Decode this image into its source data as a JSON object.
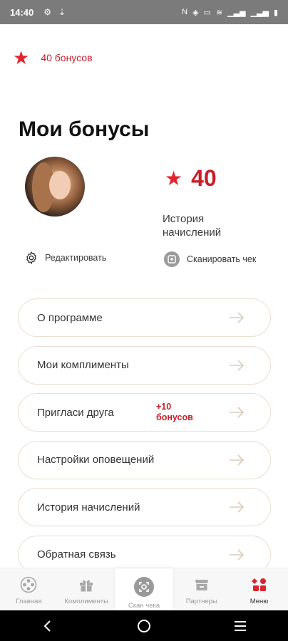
{
  "status_bar": {
    "time": "14:40"
  },
  "top_bonus": {
    "text": "40 бонусов"
  },
  "page_title": "Мои бонусы",
  "bonus": {
    "value": "40",
    "history_link": "История начислений"
  },
  "actions": {
    "edit": "Редактировать",
    "scan": "Сканировать чек"
  },
  "menu": [
    {
      "label": "О программе"
    },
    {
      "label": "Мои комплименты"
    },
    {
      "label": "Пригласи друга",
      "promo": "+10 бонусов"
    },
    {
      "label": "Настройки оповещений"
    },
    {
      "label": "История начислений"
    },
    {
      "label": "Обратная связь"
    }
  ],
  "tabs": [
    {
      "label": "Главная",
      "icon": "home-icon"
    },
    {
      "label": "Комплименты",
      "icon": "gift-icon"
    },
    {
      "label": "Скан чека",
      "icon": "scan-icon"
    },
    {
      "label": "Партнеры",
      "icon": "store-icon"
    },
    {
      "label": "Меню",
      "icon": "menu-icon"
    }
  ],
  "colors": {
    "accent": "#e3232c",
    "accent_text": "#c8202a",
    "border": "#e8dfd3"
  }
}
